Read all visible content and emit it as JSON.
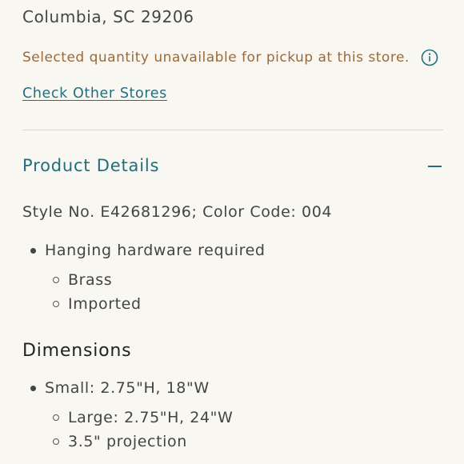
{
  "store": {
    "address_line": "Columbia, SC 29206",
    "availability_notice": "Selected quantity unavailable for pickup at this store.",
    "info_icon": "info-circle-icon",
    "check_other_stores_label": "Check Other Stores"
  },
  "product_details": {
    "title": "Product Details",
    "toggle_icon": "minus-icon",
    "style_line": "Style No. E42681296; Color Code: 004",
    "bullets": [
      {
        "text": "Hanging hardware required",
        "children": [
          "Brass",
          "Imported"
        ]
      }
    ]
  },
  "dimensions": {
    "title": "Dimensions",
    "bullets": [
      {
        "text": "Small: 2.75\"H, 18\"W",
        "children": [
          "Large: 2.75\"H, 24\"W",
          "3.5\" projection"
        ]
      }
    ]
  },
  "colors": {
    "background": "#f8f7f2",
    "accent": "#1f6f80",
    "warning": "#9a6a3a",
    "text": "#444444"
  }
}
